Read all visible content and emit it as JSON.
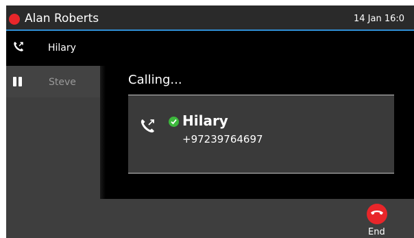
{
  "header": {
    "user_name": "Alan Roberts",
    "datetime": "14 Jan 16:0"
  },
  "calls": [
    {
      "name": "Hilary",
      "state": "active"
    },
    {
      "name": "Steve",
      "state": "held"
    }
  ],
  "main": {
    "status_label": "Calling...",
    "contact_name": "Hilary",
    "contact_number": "+97239764697"
  },
  "softkeys": {
    "end_label": "End"
  },
  "colors": {
    "accent": "#2f8fd6",
    "end_red": "#e8262a",
    "presence_green": "#3cb83c"
  }
}
